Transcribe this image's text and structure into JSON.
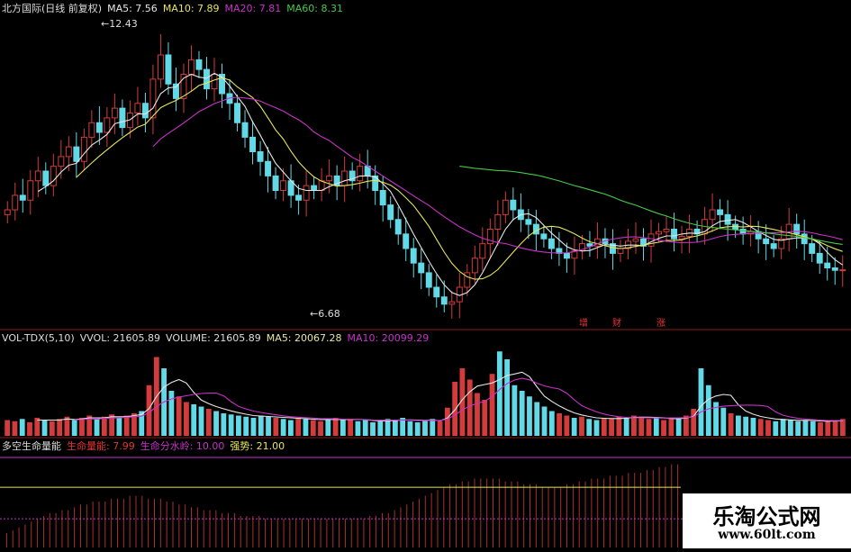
{
  "colors": {
    "bg": "#000000",
    "divider": "#8a1a1a",
    "up": "#d23c3c",
    "down": "#62d9e6",
    "ma5": "#e6e6e6",
    "ma10": "#e6e65a",
    "ma20": "#c832c8",
    "ma60": "#46c846",
    "vol_ma5": "#e6e6e6",
    "vol_ma10": "#c832c8",
    "life_line": "#e6e65a",
    "life_bar": "#a83030",
    "event_mark": "#e63333"
  },
  "price_panel": {
    "title": "北方国际(日线 前复权)",
    "legend": [
      {
        "text": "MA5: 7.56",
        "color": "#e6e6e6"
      },
      {
        "text": "MA10: 7.89",
        "color": "#e6e65a"
      },
      {
        "text": "MA20: 7.81",
        "color": "#c832c8"
      },
      {
        "text": "MA60: 8.31",
        "color": "#46c846"
      }
    ],
    "high_label": "12.43",
    "low_label": "6.68",
    "events": [
      {
        "text": "增",
        "x": 647
      },
      {
        "text": "财",
        "x": 684
      },
      {
        "text": "涨",
        "x": 733
      }
    ]
  },
  "volume_panel": {
    "legend": [
      {
        "text": "VOL-TDX(5,10)",
        "color": "#dddddd"
      },
      {
        "text": "VVOL: 21605.89",
        "color": "#dddddd"
      },
      {
        "text": "VOLUME: 21605.89",
        "color": "#dddddd"
      },
      {
        "text": "MA5: 20067.28",
        "color": "#e6e6a0"
      },
      {
        "text": "MA10: 20099.29",
        "color": "#c832c8"
      }
    ]
  },
  "life_panel": {
    "legend": [
      {
        "text": "多空生命量能",
        "color": "#dddddd"
      },
      {
        "text": "生命量能: 7.99",
        "color": "#e63333"
      },
      {
        "text": "生命分水岭: 10.00",
        "color": "#c832c8"
      },
      {
        "text": "强势: 21.00",
        "color": "#e6e65a"
      }
    ]
  },
  "watermark": {
    "title": "乐淘公式网",
    "url": "www.60lt.com"
  },
  "chart_data": [
    {
      "type": "candlestick",
      "title": "北方国际(日线 前复权)",
      "ylim": [
        6.4,
        12.8
      ],
      "y_anchor_high": 12.43,
      "y_anchor_low": 6.68,
      "close": [
        8.8,
        9.1,
        9.0,
        9.4,
        9.6,
        9.3,
        9.7,
        9.9,
        10.1,
        9.8,
        10.3,
        10.6,
        10.4,
        10.7,
        10.9,
        10.5,
        10.8,
        11.0,
        10.7,
        11.5,
        12.0,
        11.4,
        11.1,
        11.6,
        11.9,
        11.7,
        11.3,
        11.6,
        11.2,
        11.0,
        10.6,
        10.3,
        10.0,
        9.8,
        9.5,
        9.2,
        9.4,
        9.1,
        9.0,
        9.3,
        9.2,
        9.4,
        9.5,
        9.3,
        9.6,
        9.4,
        9.7,
        9.5,
        9.2,
        8.9,
        8.6,
        8.3,
        8.0,
        7.7,
        7.5,
        7.2,
        7.0,
        6.85,
        6.9,
        7.2,
        7.5,
        7.8,
        8.1,
        8.4,
        8.7,
        9.0,
        8.8,
        8.6,
        8.5,
        8.3,
        8.2,
        8.0,
        7.9,
        7.8,
        7.95,
        8.1,
        8.05,
        8.2,
        8.1,
        7.9,
        8.0,
        8.15,
        8.2,
        8.05,
        8.3,
        8.35,
        8.4,
        8.2,
        8.25,
        8.4,
        8.3,
        8.6,
        8.8,
        8.7,
        8.5,
        8.4,
        8.3,
        8.35,
        8.2,
        8.1,
        8.0,
        8.2,
        8.5,
        8.3,
        8.1,
        7.9,
        7.7,
        7.6,
        7.55,
        7.56
      ],
      "high_point": {
        "index": 20,
        "value": 12.43
      },
      "low_point": {
        "index": 57,
        "value": 6.68
      },
      "series": [
        {
          "name": "MA5",
          "last": 7.56
        },
        {
          "name": "MA10",
          "last": 7.89
        },
        {
          "name": "MA20",
          "last": 7.81
        },
        {
          "name": "MA60",
          "last": 8.31
        }
      ]
    },
    {
      "type": "bar",
      "title": "VOL-TDX(5,10)",
      "values": [
        14,
        13,
        15,
        12,
        16,
        14,
        13,
        15,
        17,
        14,
        16,
        18,
        15,
        17,
        19,
        16,
        18,
        20,
        22,
        45,
        70,
        60,
        40,
        35,
        30,
        28,
        26,
        24,
        22,
        20,
        19,
        18,
        17,
        16,
        18,
        17,
        16,
        15,
        14,
        16,
        15,
        14,
        13,
        15,
        16,
        14,
        15,
        13,
        14,
        12,
        13,
        15,
        14,
        16,
        13,
        12,
        14,
        15,
        13,
        25,
        48,
        60,
        50,
        38,
        32,
        55,
        75,
        68,
        45,
        40,
        35,
        30,
        26,
        22,
        20,
        18,
        16,
        17,
        15,
        14,
        16,
        15,
        17,
        16,
        18,
        17,
        15,
        16,
        14,
        15,
        16,
        18,
        24,
        60,
        45,
        30,
        25,
        20,
        18,
        17,
        16,
        15,
        14,
        13,
        15,
        14,
        13,
        14,
        13,
        12,
        13,
        14,
        15
      ],
      "ylim": [
        0,
        80
      ],
      "series": [
        {
          "name": "VVOL",
          "last": 21605.89
        },
        {
          "name": "VOLUME",
          "last": 21605.89
        },
        {
          "name": "MA5",
          "last": 20067.28
        },
        {
          "name": "MA10",
          "last": 20099.29
        }
      ]
    },
    {
      "type": "bar",
      "title": "多空生命量能",
      "values": [
        5,
        6,
        7,
        8,
        9,
        10,
        11,
        12,
        12,
        13,
        13,
        14,
        15,
        15,
        16,
        16,
        16,
        17,
        17,
        17,
        18,
        18,
        18,
        17,
        17,
        17,
        16,
        16,
        15,
        15,
        14,
        14,
        13,
        13,
        13,
        12,
        12,
        12,
        11,
        11,
        11,
        11,
        10,
        10,
        10,
        10,
        10,
        10,
        10,
        10,
        10,
        10,
        10,
        10,
        10,
        10,
        10,
        10,
        10,
        11,
        11,
        12,
        12,
        13,
        14,
        15,
        16,
        17,
        18,
        19,
        20,
        21,
        22,
        22,
        23,
        23,
        24,
        24,
        24,
        24,
        24,
        23,
        23,
        23,
        22,
        22,
        22,
        21,
        21,
        21,
        21,
        22,
        22,
        23,
        23,
        24,
        24,
        24,
        25,
        25,
        25,
        26,
        26,
        26,
        27,
        27,
        28,
        28,
        29,
        29
      ],
      "ylim": [
        0,
        32
      ],
      "series": [
        {
          "name": "生命量能",
          "last": 7.99
        },
        {
          "name": "生命分水岭",
          "last": 10.0
        },
        {
          "name": "强势",
          "last": 21.0
        }
      ]
    }
  ]
}
